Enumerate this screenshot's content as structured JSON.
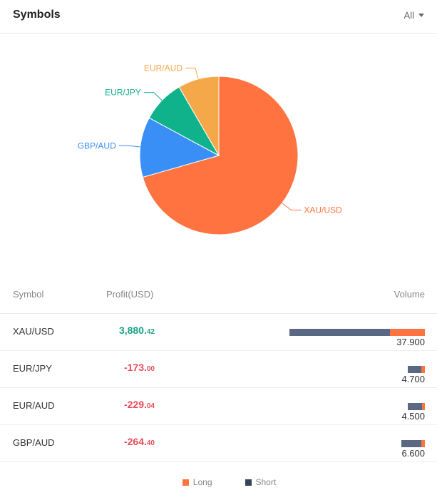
{
  "header": {
    "title": "Symbols",
    "filter_label": "All"
  },
  "chart_data": {
    "type": "pie",
    "slices": [
      {
        "label": "XAU/USD",
        "value": 37.9,
        "color": "#ff7340"
      },
      {
        "label": "GBP/AUD",
        "value": 6.6,
        "color": "#3a8ff7"
      },
      {
        "label": "EUR/JPY",
        "value": 4.7,
        "color": "#10b28c"
      },
      {
        "label": "EUR/AUD",
        "value": 4.5,
        "color": "#f5a84a"
      }
    ]
  },
  "table": {
    "columns": {
      "symbol": "Symbol",
      "profit": "Profit(USD)",
      "volume": "Volume"
    },
    "rows": [
      {
        "symbol": "XAU/USD",
        "profit_int": "3,880.",
        "profit_dec": "42",
        "sign": "pos",
        "volume": "37.900",
        "short_share": 0.74,
        "long_share": 0.26
      },
      {
        "symbol": "EUR/JPY",
        "profit_int": "-173.",
        "profit_dec": "00",
        "sign": "neg",
        "volume": "4.700",
        "short_share": 0.78,
        "long_share": 0.22
      },
      {
        "symbol": "EUR/AUD",
        "profit_int": "-229.",
        "profit_dec": "04",
        "sign": "neg",
        "volume": "4.500",
        "short_share": 0.87,
        "long_share": 0.13
      },
      {
        "symbol": "GBP/AUD",
        "profit_int": "-264.",
        "profit_dec": "40",
        "sign": "neg",
        "volume": "6.600",
        "short_share": 0.86,
        "long_share": 0.14
      }
    ]
  },
  "legend": {
    "items": [
      {
        "label": "Long",
        "color": "#ff7340"
      },
      {
        "label": "Short",
        "color": "#34445b"
      }
    ]
  }
}
